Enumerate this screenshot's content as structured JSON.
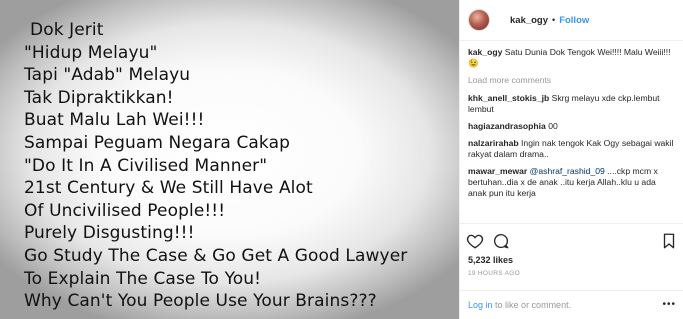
{
  "post_image": {
    "lines": [
      "Dok Jerit",
      "\"Hidup Melayu\"",
      "Tapi \"Adab\" Melayu",
      "Tak Dipraktikkan!",
      "Buat Malu Lah Wei!!!",
      "Sampai Peguam Negara Cakap",
      "\"Do It In A Civilised Manner\"",
      "21st Century & We Still Have Alot",
      "Of Uncivilised People!!!",
      "Purely Disgusting!!!",
      "Go Study The Case & Go Get A Good Lawyer",
      "To Explain The Case To You!",
      "Why Can't You People Use Your Brains???"
    ]
  },
  "header": {
    "username": "kak_ogy",
    "separator": "•",
    "follow_label": "Follow"
  },
  "caption": {
    "user": "kak_ogy",
    "text": "Satu Dunia Dok Tengok Wei!!!! Malu Weiii!!! 😉"
  },
  "load_more_label": "Load more comments",
  "comments": [
    {
      "user": "khk_anell_stokis_jb",
      "text": "Skrg melayu xde ckp.lembut lembut"
    },
    {
      "user": "hagiazandrasophia",
      "text": "00"
    },
    {
      "user": "nalzarirahab",
      "text": "Ingin nak tengok Kak Ogy sebagai wakil rakyat dalam drama.."
    },
    {
      "user": "mawar_mewar",
      "mention": "@ashraf_rashid_09",
      "text": "....ckp mcm x bertuhan..dia x de anak ..itu kerja Allah..klu u ada anak pun itu kerja"
    }
  ],
  "likes_text": "5,232 likes",
  "timestamp": "19 HOURS AGO",
  "login_bar": {
    "login_label": "Log in",
    "rest": "to like or comment.",
    "more": "•••"
  }
}
